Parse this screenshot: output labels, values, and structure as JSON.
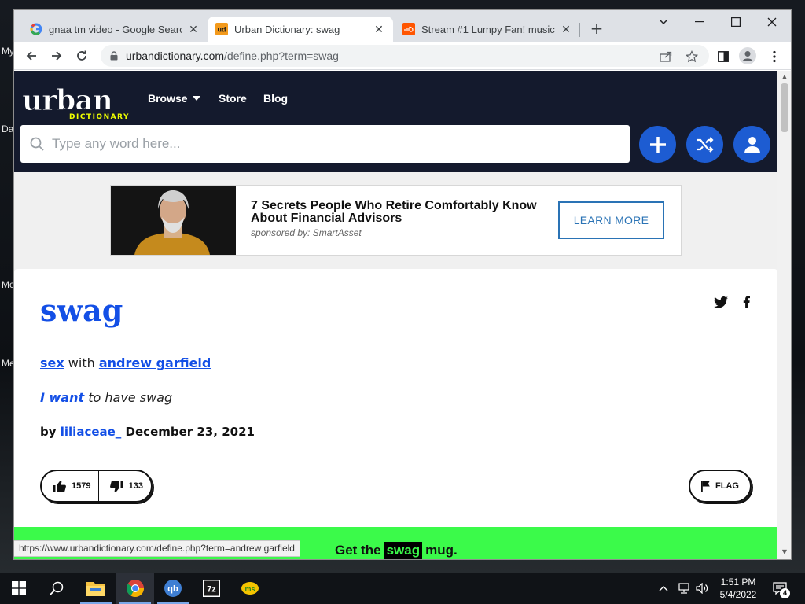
{
  "desktop": {
    "fragments": [
      "My",
      "Da",
      "Me",
      "Me"
    ]
  },
  "browser": {
    "tabs": [
      {
        "title": "gnaa tm video - Google Search",
        "icon": "google-icon",
        "active": false
      },
      {
        "title": "Urban Dictionary: swag",
        "icon": "urban-dictionary-icon",
        "active": true
      },
      {
        "title": "Stream #1 Lumpy Fan! music | Li",
        "icon": "soundcloud-icon",
        "active": false
      }
    ],
    "url_host": "urbandictionary.com",
    "url_path": "/define.php?term=swag",
    "status_url": "https://www.urbandictionary.com/define.php?term=andrew garfield"
  },
  "ud": {
    "logo_word": "urban",
    "logo_sub": "DICTIONARY",
    "nav": {
      "browse": "Browse",
      "store": "Store",
      "blog": "Blog"
    },
    "search_placeholder": "Type any word here..."
  },
  "ad": {
    "headline": "7 Secrets People Who Retire Comfortably Know About Financial Advisors",
    "sponsor": "sponsored by: SmartAsset",
    "cta": "LEARN MORE"
  },
  "definition": {
    "word": "swag",
    "meaning_link1": "sex",
    "meaning_mid": "with",
    "meaning_link2": "andrew garfield",
    "example_link": "I want",
    "example_rest": "to have swag",
    "by": "by",
    "author": "liliaceae_",
    "date": "December 23, 2021",
    "upvotes": "1579",
    "downvotes": "133",
    "flag": "FLAG"
  },
  "promo": {
    "before": "Get the",
    "highlight": "swag",
    "after": "mug."
  },
  "taskbar": {
    "time": "1:51 PM",
    "date": "5/4/2022",
    "notifications": "4"
  },
  "colors": {
    "ud_header": "#141a2d",
    "ud_blue": "#134fe6",
    "promo_green": "#3bfa4a"
  }
}
